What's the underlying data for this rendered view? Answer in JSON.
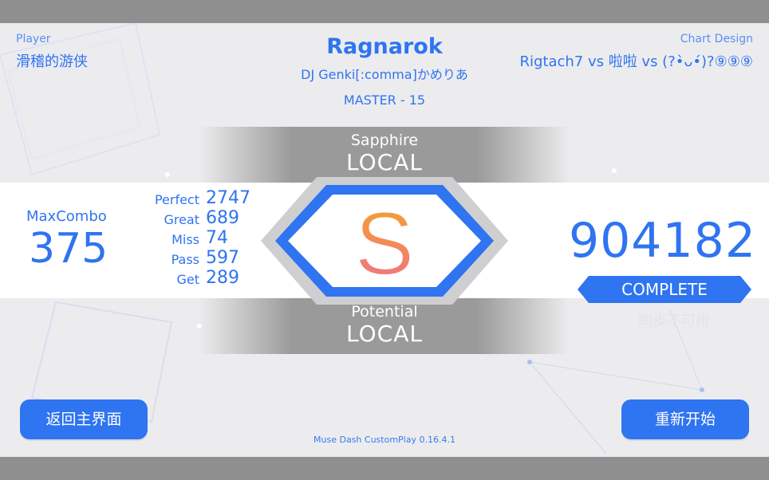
{
  "header": {
    "player_label": "Player",
    "player_name": "滑稽的游侠",
    "song_title": "Ragnarok",
    "artist": "DJ Genki[:comma]かめりあ",
    "difficulty": "MASTER - 15",
    "chart_design_label": "Chart Design",
    "chart_designer": "Rigtach7 vs 啦啦 vs (?•̀ᴗ•́)?⑨⑨⑨"
  },
  "ranking": {
    "top_label": "Sapphire",
    "top_value": "LOCAL",
    "bottom_label": "Potential",
    "bottom_value": "LOCAL"
  },
  "stats": {
    "max_combo_label": "MaxCombo",
    "max_combo": "375",
    "judgements": [
      {
        "label": "Perfect",
        "value": "2747"
      },
      {
        "label": "Great",
        "value": "689"
      },
      {
        "label": "Miss",
        "value": "74"
      },
      {
        "label": "Pass",
        "value": "597"
      },
      {
        "label": "Get",
        "value": "289"
      }
    ]
  },
  "grade": "S",
  "score": "904182",
  "status": "COMPLETE",
  "sync_note": "同步不可用",
  "buttons": {
    "back": "返回主界面",
    "retry": "重新开始"
  },
  "footer": {
    "version": "Muse Dash CustomPlay 0.16.4.1"
  },
  "colors": {
    "accent": "#2f74f0",
    "grade_top": "#f5a623",
    "grade_bottom": "#ef6f8f",
    "panel": "#ececee",
    "frame": "#8f8f8f"
  }
}
